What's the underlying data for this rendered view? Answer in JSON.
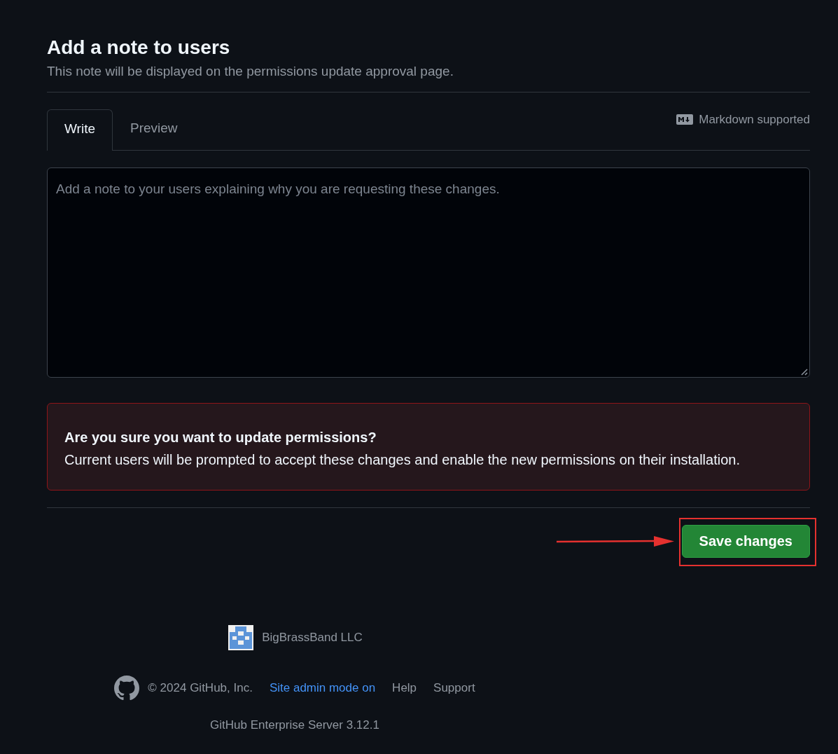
{
  "header": {
    "title": "Add a note to users",
    "description": "This note will be displayed on the permissions update approval page."
  },
  "tabs": [
    {
      "label": "Write",
      "selected": true
    },
    {
      "label": "Preview",
      "selected": false
    }
  ],
  "markdown_hint": "Markdown supported",
  "note_field": {
    "placeholder": "Add a note to your users explaining why you are requesting these changes."
  },
  "warning": {
    "title": "Are you sure you want to update permissions?",
    "body": "Current users will be prompted to accept these changes and enable the new permissions on their installation."
  },
  "save_button": "Save changes",
  "footer": {
    "org": "BigBrassBand LLC",
    "copyright": "© 2024 GitHub, Inc.",
    "links": [
      {
        "label": "Site admin mode on",
        "kind": "accent"
      },
      {
        "label": "Help",
        "kind": "plain"
      },
      {
        "label": "Support",
        "kind": "plain"
      }
    ],
    "version": "GitHub Enterprise Server 3.12.1"
  }
}
